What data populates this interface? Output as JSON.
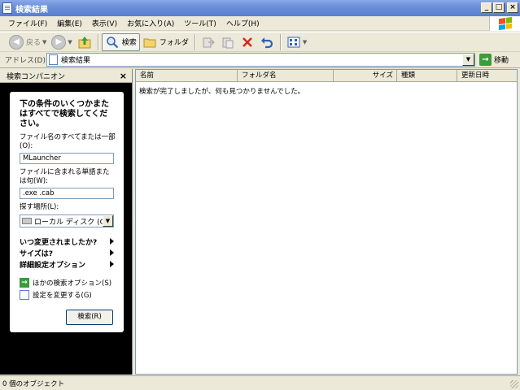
{
  "window": {
    "title": "検索結果"
  },
  "menu": [
    "ファイル(F)",
    "編集(E)",
    "表示(V)",
    "お気に入り(A)",
    "ツール(T)",
    "ヘルプ(H)"
  ],
  "toolbar": {
    "back": "戻る",
    "search": "検索",
    "folders": "フォルダ"
  },
  "address": {
    "label": "アドレス(D)",
    "value": "検索結果",
    "go": "移動"
  },
  "pane": {
    "title": "検索コンパニオン",
    "heading": "下の条件のいくつかまたはすべてで検索してください。",
    "name_label": "ファイル名のすべてまたは一部(O):",
    "name_value": "MLauncher",
    "words_label": "ファイルに含まれる単語または句(W):",
    "words_value": ".exe .cab",
    "lookin_label": "探す場所(L):",
    "lookin_value": "ローカル ディスク (C:)",
    "when_modified": "いつ変更されましたか?",
    "what_size": "サイズは?",
    "advanced": "詳細設定オプション",
    "other_options": "ほかの検索オプション(S)",
    "change_prefs": "設定を変更する(G)",
    "search_button": "検索(R)"
  },
  "list": {
    "columns": [
      "名前",
      "フォルダ名",
      "サイズ",
      "種類",
      "更新日時"
    ],
    "empty_message": "検索が完了しましたが、何も見つかりませんでした。"
  },
  "status": {
    "text": "0 個のオブジェクト"
  }
}
